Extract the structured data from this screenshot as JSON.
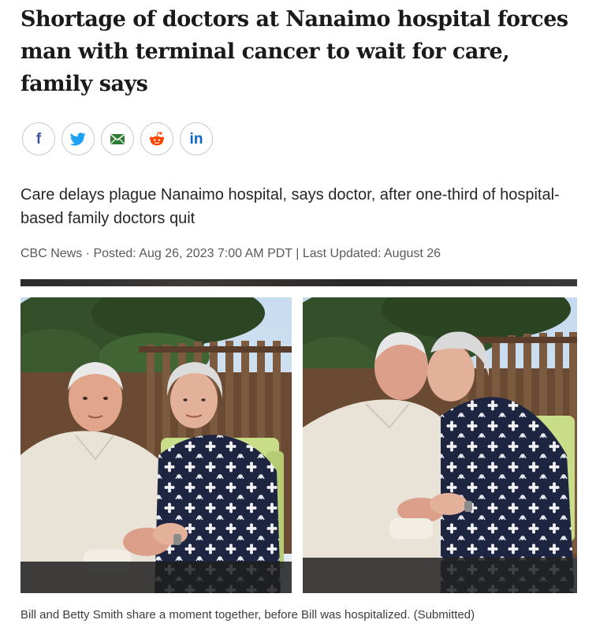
{
  "article": {
    "headline": "Shortage of doctors at Nanaimo hospital forces man with terminal cancer to wait for care, family says",
    "deck": "Care delays plague Nanaimo hospital, says doctor, after one-third of hospital-based family doctors quit",
    "byline": "CBC News · Posted: Aug 26, 2023 7:00 AM PDT | Last Updated: August 26"
  },
  "share": {
    "facebook_glyph": "f",
    "linkedin_glyph": "in",
    "icons": [
      "facebook-icon",
      "twitter-icon",
      "email-icon",
      "reddit-icon",
      "linkedin-icon"
    ]
  },
  "figure": {
    "caption": "Bill and Betty Smith share a moment together, before Bill was hospitalized. (Submitted)"
  },
  "colors": {
    "facebook": "#3b5998",
    "twitter": "#1da1f2",
    "email": "#2e7d32",
    "reddit": "#ff4500",
    "linkedin": "#0a66c2"
  }
}
